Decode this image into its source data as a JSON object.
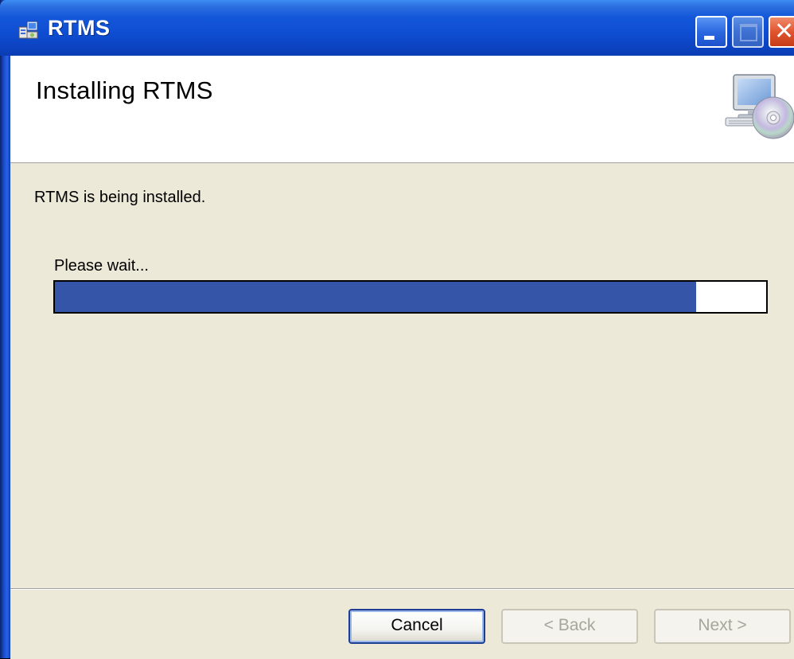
{
  "window": {
    "title": "RTMS",
    "controls": {
      "minimize": "minimize",
      "maximize": "maximize",
      "close": "✕"
    }
  },
  "banner": {
    "title": "Installing RTMS",
    "icon": "computer-cd-icon"
  },
  "body": {
    "status": "RTMS is being installed.",
    "wait": "Please wait...",
    "progress_fraction": 0.902
  },
  "footer": {
    "cancel_label": "Cancel",
    "back_label": "< Back",
    "next_label": "Next >",
    "back_enabled": false,
    "next_enabled": false
  },
  "colors": {
    "titlebar": "#0f4fd4",
    "progress_fill": "#3556a8",
    "dialog_bg": "#ece9d8"
  }
}
